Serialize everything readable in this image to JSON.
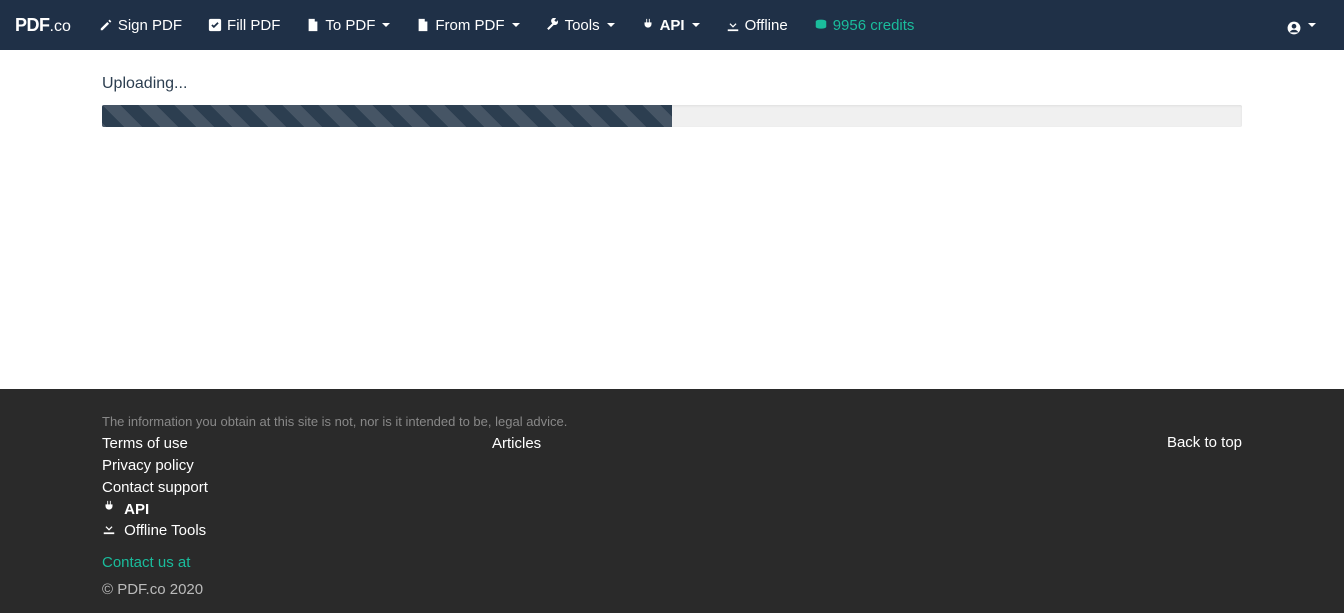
{
  "brand": {
    "part1": "PDF",
    "part2": ".co"
  },
  "nav": {
    "sign_pdf": "Sign PDF",
    "fill_pdf": "Fill PDF",
    "to_pdf": "To PDF",
    "from_pdf": "From PDF",
    "tools": "Tools",
    "api": "API",
    "offline": "Offline",
    "credits": "9956 credits"
  },
  "main": {
    "uploading_label": "Uploading...",
    "progress_percent": 50
  },
  "footer": {
    "disclaimer": "The information you obtain at this site is not, nor is it intended to be, legal advice.",
    "links_col1": {
      "terms": "Terms of use",
      "privacy": "Privacy policy",
      "support": "Contact support",
      "api": "API",
      "offline_tools": "Offline Tools"
    },
    "links_col2": {
      "articles": "Articles"
    },
    "back_to_top": "Back to top",
    "contact_us": "Contact us at",
    "copyright": "© PDF.co 2020"
  }
}
